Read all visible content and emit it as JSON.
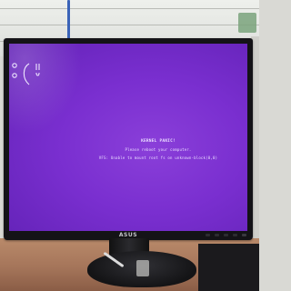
{
  "screen": {
    "emoticon": ":(",
    "title": "KERNEL PANIC!",
    "line1": "Please reboot your computer.",
    "line2": "VFS: Unable to mount root fs on unknown-block(0,0)"
  },
  "monitor": {
    "brand": "ASUS"
  },
  "colors": {
    "screen": "#7a2fd0",
    "bezel": "#141317",
    "desk": "#a5755a"
  }
}
